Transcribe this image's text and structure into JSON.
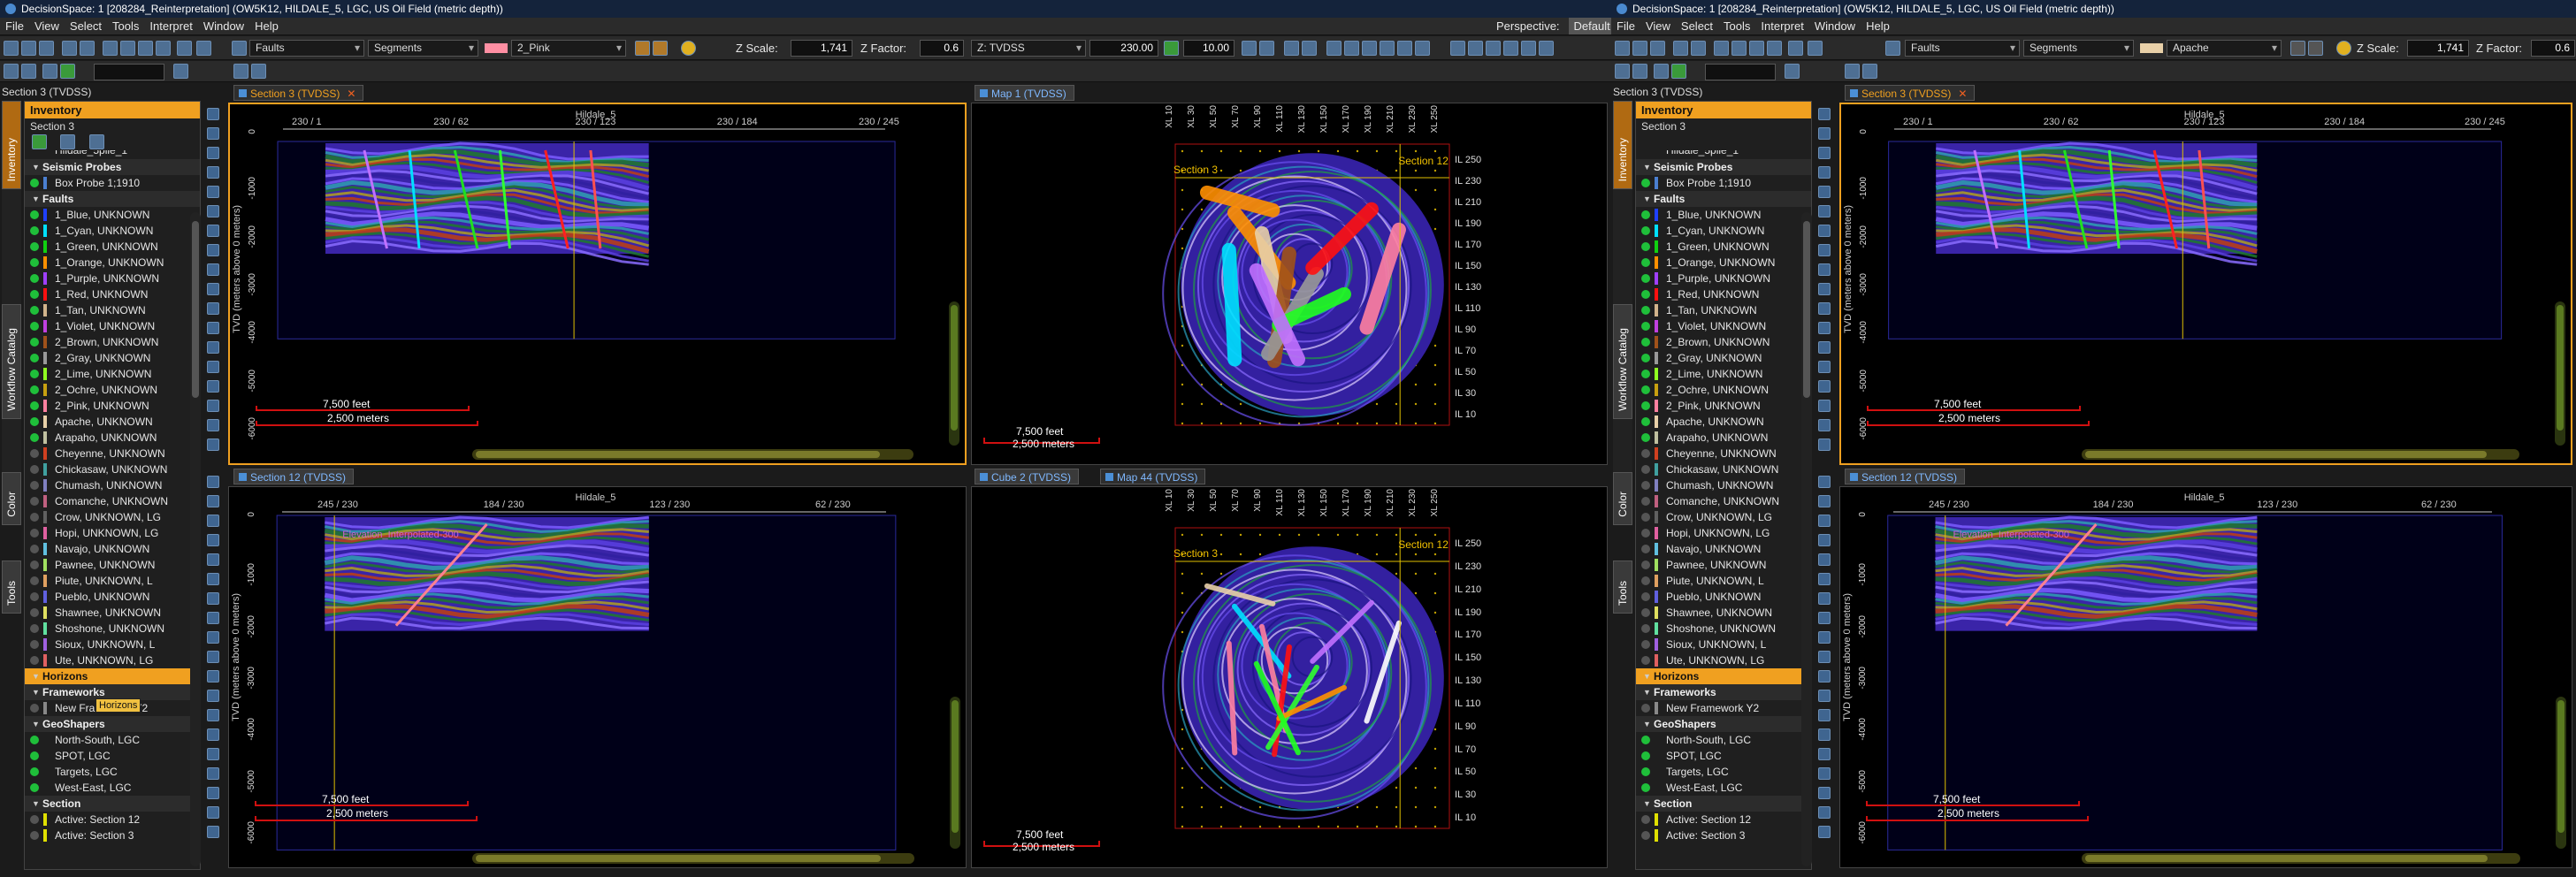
{
  "windows": [
    {
      "title": "DecisionSpace: 1 [208284_Reinterpretation] (OW5K12, HILDALE_5, LGC, US Oil Field (metric depth))",
      "menu": [
        "File",
        "View",
        "Select",
        "Tools",
        "Interpret",
        "Window",
        "Help"
      ],
      "perspective_label": "Perspective:",
      "perspective_value": "Default",
      "toolbar": {
        "faults": "Faults",
        "segments": "Segments",
        "color_name": "2_Pink",
        "color_hex": "#ff8fa3",
        "zscale_label": "Z Scale:",
        "zscale_value": "1,741",
        "zfactor_label": "Z Factor:",
        "zfactor_value": "0.6",
        "domain": "Z: TVDSS",
        "depth_value": "230.00",
        "step_value": "10.00"
      },
      "view_title": "Section 3 (TVDSS)"
    },
    {
      "title": "DecisionSpace: 1 [208284_Reinterpretation] (OW5K12, HILDALE_5, LGC, US Oil Field (metric depth))",
      "menu": [
        "File",
        "View",
        "Select",
        "Tools",
        "Interpret",
        "Window",
        "Help"
      ],
      "toolbar": {
        "faults": "Faults",
        "segments": "Segments",
        "color_name": "Apache",
        "color_hex": "#e8d0a8",
        "zscale_label": "Z Scale:",
        "zscale_value": "1,741",
        "zfactor_label": "Z Factor:",
        "zfactor_value": "0.6"
      },
      "view_title": "Section 3 (TVDSS)"
    }
  ],
  "side_tabs": [
    "Inventory",
    "Workflow Catalog",
    "Color",
    "Tools"
  ],
  "inventory": {
    "title": "Inventory",
    "subtitle": "Section 3",
    "top_partial": "Hildale_5plie_1",
    "tooltip": "Horizons",
    "items": [
      {
        "type": "section",
        "label": "Seismic Probes"
      },
      {
        "type": "item",
        "label": "Box Probe 1;1910",
        "color": "#4a7fd0",
        "dot": true
      },
      {
        "type": "section",
        "label": "Faults"
      },
      {
        "type": "item",
        "label": "1_Blue, UNKNOWN",
        "color": "#1f40ff",
        "dot": true
      },
      {
        "type": "item",
        "label": "1_Cyan, UNKNOWN",
        "color": "#00e0ff",
        "dot": true
      },
      {
        "type": "item",
        "label": "1_Green, UNKNOWN",
        "color": "#10d010",
        "dot": true
      },
      {
        "type": "item",
        "label": "1_Orange, UNKNOWN",
        "color": "#ff9000",
        "dot": true
      },
      {
        "type": "item",
        "label": "1_Purple, UNKNOWN",
        "color": "#a040ff",
        "dot": true
      },
      {
        "type": "item",
        "label": "1_Red, UNKNOWN",
        "color": "#ff1010",
        "dot": true
      },
      {
        "type": "item",
        "label": "1_Tan, UNKNOWN",
        "color": "#d2b48c",
        "dot": true
      },
      {
        "type": "item",
        "label": "1_Violet, UNKNOWN",
        "color": "#c040e0",
        "dot": true
      },
      {
        "type": "item",
        "label": "2_Brown, UNKNOWN",
        "color": "#a0521a",
        "dot": true
      },
      {
        "type": "item",
        "label": "2_Gray, UNKNOWN",
        "color": "#999999",
        "dot": true
      },
      {
        "type": "item",
        "label": "2_Lime, UNKNOWN",
        "color": "#90ff20",
        "dot": true
      },
      {
        "type": "item",
        "label": "2_Ochre, UNKNOWN",
        "color": "#c8a010",
        "dot": true
      },
      {
        "type": "item",
        "label": "2_Pink, UNKNOWN",
        "color": "#ff80a0",
        "dot": true
      },
      {
        "type": "item",
        "label": "Apache, UNKNOWN",
        "color": "#e8d0a8",
        "dot": true
      },
      {
        "type": "item",
        "label": "Arapaho, UNKNOWN",
        "color": "#c0c0a0",
        "dot": true
      },
      {
        "type": "item",
        "label": "Cheyenne, UNKNOWN",
        "color": "#d04020",
        "dot": false
      },
      {
        "type": "item",
        "label": "Chickasaw, UNKNOWN",
        "color": "#40a0a0",
        "dot": false
      },
      {
        "type": "item",
        "label": "Chumash, UNKNOWN",
        "color": "#8080c0",
        "dot": false
      },
      {
        "type": "item",
        "label": "Comanche, UNKNOWN",
        "color": "#c06080",
        "dot": false
      },
      {
        "type": "item",
        "label": "Crow, UNKNOWN, LG",
        "color": "#606060",
        "dot": false
      },
      {
        "type": "item",
        "label": "Hopi, UNKNOWN, LG",
        "color": "#e060a0",
        "dot": false
      },
      {
        "type": "item",
        "label": "Navajo, UNKNOWN",
        "color": "#60c0e0",
        "dot": false
      },
      {
        "type": "item",
        "label": "Pawnee, UNKNOWN",
        "color": "#a0e060",
        "dot": false
      },
      {
        "type": "item",
        "label": "Piute, UNKNOWN, L",
        "color": "#e0a060",
        "dot": false
      },
      {
        "type": "item",
        "label": "Pueblo, UNKNOWN",
        "color": "#6060e0",
        "dot": false
      },
      {
        "type": "item",
        "label": "Shawnee, UNKNOWN",
        "color": "#e0e060",
        "dot": false
      },
      {
        "type": "item",
        "label": "Shoshone, UNKNOWN",
        "color": "#60e0a0",
        "dot": false
      },
      {
        "type": "item",
        "label": "Sioux, UNKNOWN, L",
        "color": "#a060e0",
        "dot": false
      },
      {
        "type": "item",
        "label": "Ute, UNKNOWN, LG",
        "color": "#e06060",
        "dot": false
      },
      {
        "type": "section",
        "label": "Horizons",
        "highlight": true
      },
      {
        "type": "section",
        "label": "Frameworks"
      },
      {
        "type": "item",
        "label": "New Framework Y2",
        "color": "#888888",
        "dot": false
      },
      {
        "type": "section",
        "label": "GeoShapers"
      },
      {
        "type": "item",
        "label": "North-South, LGC",
        "color": "",
        "dot": true
      },
      {
        "type": "item",
        "label": "SPOT, LGC",
        "color": "",
        "dot": true
      },
      {
        "type": "item",
        "label": "Targets, LGC",
        "color": "",
        "dot": true
      },
      {
        "type": "item",
        "label": "West-East, LGC",
        "color": "",
        "dot": true
      },
      {
        "type": "section",
        "label": "Section"
      },
      {
        "type": "item",
        "label": "Active: Section 12",
        "color": "#e0e000",
        "dot": false
      },
      {
        "type": "item",
        "label": "Active: Section 3",
        "color": "#e0e000",
        "dot": false
      }
    ]
  },
  "views": {
    "section3": {
      "tab": "Section 3 (TVDSS)",
      "line": "Hildale_5",
      "ticks": [
        "230 / 1",
        "230 / 62",
        "230 / 123",
        "230 / 184",
        "230 / 245"
      ],
      "yaxis": "TVD (meters above 0 meters)",
      "ylabels": [
        "0",
        "-1000",
        "-2000",
        "-3000",
        "-4000",
        "-5000",
        "-6000"
      ]
    },
    "section12": {
      "tab": "Section 12 (TVDSS)",
      "line": "Hildale_5",
      "ticks": [
        "245 / 230",
        "184 / 230",
        "123 / 230",
        "62 / 230"
      ],
      "yaxis": "TVD (meters above 0 meters)",
      "ylabels": [
        "0",
        "-1000",
        "-2000",
        "-3000",
        "-4000",
        "-5000",
        "-6000"
      ],
      "horizon_label": "Elevation_Interpolated-300"
    },
    "map1": {
      "tab": "Map 1 (TVDSS)",
      "section3": "Section 3",
      "section12": "Section 12"
    },
    "cube2": {
      "tab": "Cube 2 (TVDSS)",
      "tab2": "Map 44 (TVDSS)",
      "section3": "Section 3",
      "section12": "Section 12"
    },
    "il_labels": [
      "IL 250",
      "IL 230",
      "IL 210",
      "IL 190",
      "IL 170",
      "IL 150",
      "IL 130",
      "IL 110",
      "IL 90",
      "IL 70",
      "IL 50",
      "IL 30",
      "IL 10"
    ],
    "xl_labels": [
      "XL 10",
      "XL 30",
      "XL 50",
      "XL 70",
      "XL 90",
      "XL 110",
      "XL 130",
      "XL 150",
      "XL 170",
      "XL 190",
      "XL 210",
      "XL 230",
      "XL 250"
    ],
    "scale_feet": "7,500 feet",
    "scale_meters": "2,500 meters"
  }
}
